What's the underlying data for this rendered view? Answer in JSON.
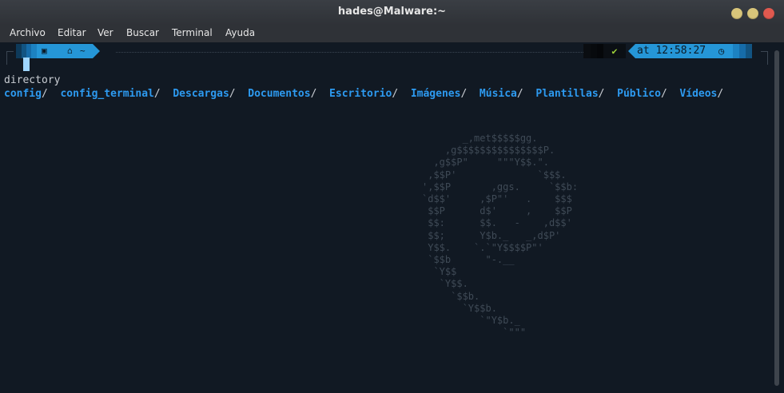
{
  "window": {
    "title": "hades@Malware:~"
  },
  "menu": {
    "items": [
      "Archivo",
      "Editar",
      "Ver",
      "Buscar",
      "Terminal",
      "Ayuda"
    ]
  },
  "prompt": {
    "left_icons": [
      "terminal-icon",
      "home-icon"
    ],
    "path": "~",
    "status_check": "✔",
    "time_label": "at 12:58:27",
    "clock_icon": "clock-icon"
  },
  "output": {
    "directory_line": "directory",
    "folders": [
      "config",
      "config_terminal",
      "Descargas",
      "Documentos",
      "Escritorio",
      "Imágenes",
      "Música",
      "Plantillas",
      "Público",
      "Vídeos"
    ]
  },
  "ascii_logo": "       _,met$$$$$gg.\n    ,g$$$$$$$$$$$$$$$P.\n  ,g$$P\"     \"\"\"Y$$.\".\n ,$$P'              `$$$.\n',$$P       ,ggs.     `$$b:\n`d$$'     ,$P\"'   .    $$$\n $$P      d$'     ,    $$P\n $$:      $$.   -    ,d$$'\n $$;      Y$b._   _,d$P'\n Y$$.    `.`\"Y$$$$P\"'\n `$$b      \"-.__\n  `Y$$\n   `Y$$.\n     `$$b.\n       `Y$$b.\n          `\"Y$b._\n              `\"\"\"",
  "colors": {
    "accent": "#2596d7",
    "folder": "#2d9af0",
    "background": "#111923",
    "close_button": "#e0594f",
    "min_max_button": "#d8c57a"
  }
}
